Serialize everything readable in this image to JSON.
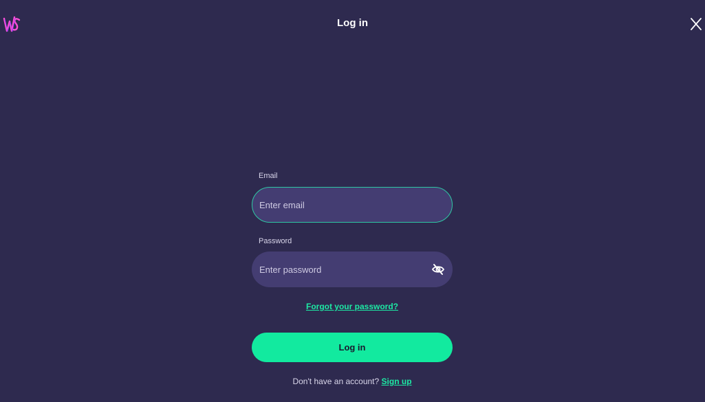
{
  "header": {
    "title": "Log in",
    "logo_icon": "ws-logo-icon",
    "close_icon": "close-icon"
  },
  "form": {
    "email_label": "Email",
    "email_placeholder": "Enter email",
    "email_value": "",
    "password_label": "Password",
    "password_placeholder": "Enter password",
    "password_value": "",
    "password_toggle_icon": "eye-slash-icon",
    "forgot_password": "Forgot your password?",
    "submit_label": "Log in",
    "signup_prompt": "Don't have an account?",
    "signup_link": "Sign up"
  },
  "colors": {
    "background": "#2e2a4f",
    "input_background": "#443d72",
    "accent": "#12ea9f",
    "focus_border": "#2ec9a4"
  }
}
